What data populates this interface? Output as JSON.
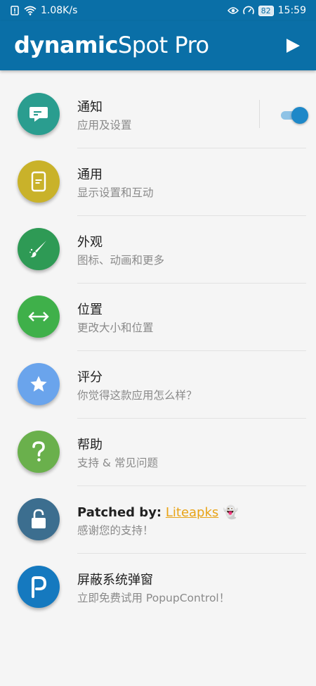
{
  "status_bar": {
    "network_speed": "1.08K/s",
    "battery_level": "82",
    "time": "15:59",
    "icons": [
      "alert-icon",
      "wifi-icon",
      "eye-icon",
      "speedometer-icon",
      "battery-icon"
    ]
  },
  "app_bar": {
    "title_bold": "dynamic",
    "title_rest": "Spot Pro",
    "background_color": "#0a6fa7",
    "play_icon": "play-icon"
  },
  "menu": {
    "items": [
      {
        "title": "通知",
        "subtitle": "应用及设置",
        "icon": "notification-bubble-icon",
        "color": "#2a9d8f",
        "toggle_on": true
      },
      {
        "title": "通用",
        "subtitle": "显示设置和互动",
        "icon": "phone-icon",
        "color": "#c9b22a"
      },
      {
        "title": "外观",
        "subtitle": "图标、动画和更多",
        "icon": "paint-brush-icon",
        "color": "#2e9a55"
      },
      {
        "title": "位置",
        "subtitle": "更改大小和位置",
        "icon": "resize-horizontal-icon",
        "color": "#3fb04a"
      },
      {
        "title": "评分",
        "subtitle": "你觉得这款应用怎么样？",
        "icon": "star-icon",
        "color": "#6aa4ec"
      },
      {
        "title": "帮助",
        "subtitle": "支持 & 常见问题",
        "icon": "question-icon",
        "color": "#6ab04c"
      },
      {
        "title_label": "Patched by:",
        "title_link": "Liteapks",
        "title_emoji": "👻",
        "subtitle": "感谢您的支持！",
        "icon": "unlock-icon",
        "color": "#3c6e8f"
      },
      {
        "title": "屏蔽系统弹窗",
        "subtitle": "立即免费试用 PopupControl！",
        "icon": "popupcontrol-logo-icon",
        "color": "#1579bf"
      }
    ]
  }
}
